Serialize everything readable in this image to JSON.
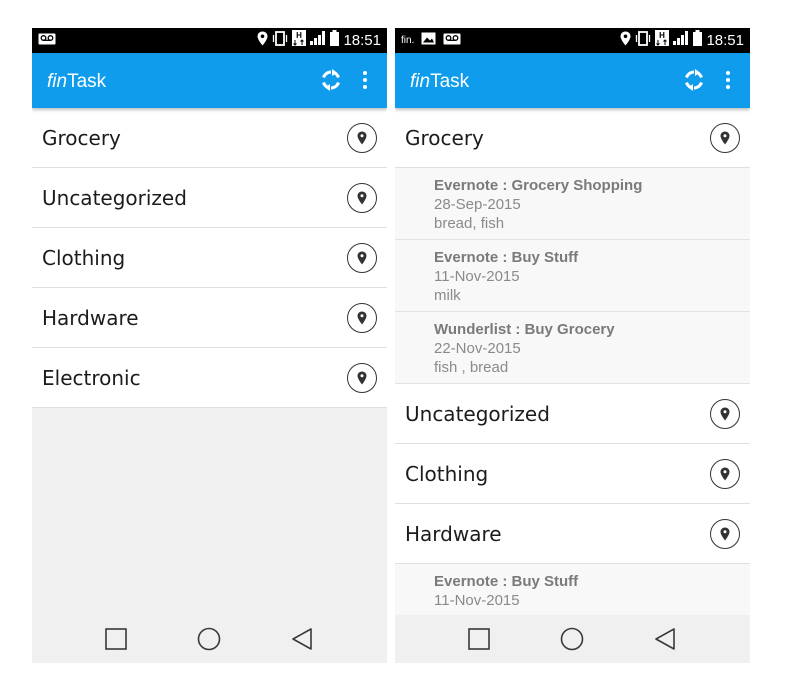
{
  "app": {
    "title_italic": "fin",
    "title_rest": "Task",
    "accent_color": "#0f9cec"
  },
  "icons": [
    "voicemail-icon",
    "image-icon",
    "location-icon",
    "vibrate-icon",
    "network-h-icon",
    "signal-icon",
    "battery-icon",
    "sync-icon",
    "more-vertical-icon",
    "location-pin-icon",
    "nav-square-icon",
    "nav-circle-icon",
    "nav-back-icon"
  ],
  "left": {
    "status": {
      "time": "18:51"
    },
    "categories": [
      {
        "label": "Grocery"
      },
      {
        "label": "Uncategorized"
      },
      {
        "label": "Clothing"
      },
      {
        "label": "Hardware"
      },
      {
        "label": "Electronic"
      }
    ]
  },
  "right": {
    "status": {
      "time": "18:51",
      "left_text": "fin."
    },
    "grocery": {
      "label": "Grocery",
      "tasks": [
        {
          "title": "Evernote : Grocery Shopping",
          "date": "28-Sep-2015",
          "note": "bread, fish"
        },
        {
          "title": "Evernote : Buy Stuff",
          "date": "11-Nov-2015",
          "note": "milk"
        },
        {
          "title": "Wunderlist : Buy Grocery",
          "date": "22-Nov-2015",
          "note": "fish , bread"
        }
      ]
    },
    "uncategorized": {
      "label": "Uncategorized"
    },
    "clothing": {
      "label": "Clothing"
    },
    "hardware": {
      "label": "Hardware",
      "tasks": [
        {
          "title": "Evernote : Buy Stuff",
          "date": "11-Nov-2015",
          "note": ""
        }
      ]
    }
  }
}
